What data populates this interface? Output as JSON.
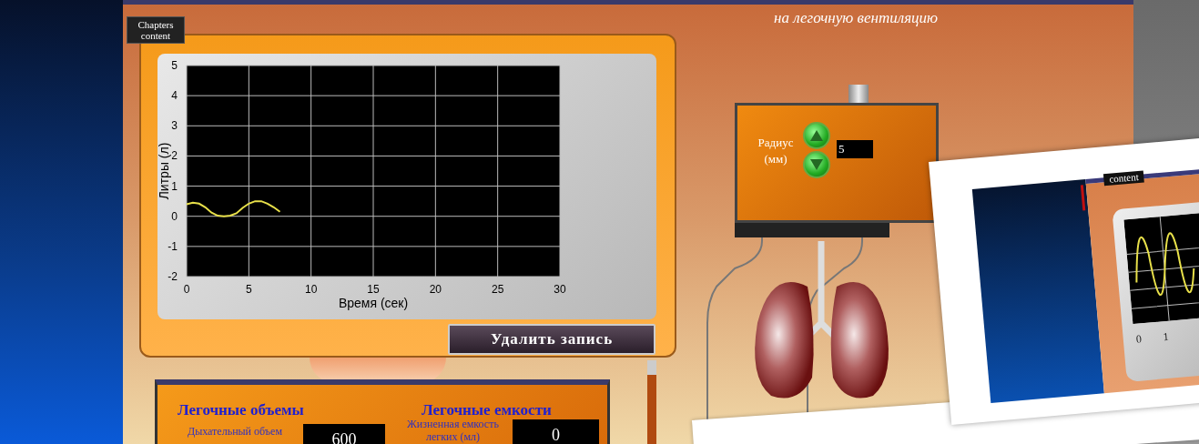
{
  "header": {
    "subtitle": "на легочную вентиляцию"
  },
  "chapters_button": {
    "label": "Chapters content"
  },
  "monitor": {
    "chart_data": {
      "type": "line",
      "grid": true,
      "xlabel": "Время (сек)",
      "ylabel": "Литры (л)",
      "xlim": [
        0,
        30
      ],
      "ylim": [
        -2,
        5
      ],
      "xticks": [
        0,
        5,
        10,
        15,
        20,
        25,
        30
      ],
      "yticks": [
        -2,
        -1,
        0,
        1,
        2,
        3,
        4,
        5
      ],
      "x": [
        0,
        0.5,
        1,
        1.5,
        2,
        2.5,
        3,
        3.5,
        4,
        4.5,
        5,
        5.5,
        6,
        6.5,
        7,
        7.5
      ],
      "series": [
        {
          "color": "#e8e04a",
          "values": [
            0.4,
            0.45,
            0.42,
            0.3,
            0.12,
            0.02,
            0.0,
            0.02,
            0.1,
            0.28,
            0.42,
            0.5,
            0.5,
            0.42,
            0.3,
            0.15
          ]
        }
      ]
    },
    "delete_button": "Удалить запись"
  },
  "radius_control": {
    "label": "Радиус (мм)",
    "value": "5"
  },
  "volumes_panel": {
    "volumes_title": "Легочные объемы",
    "capacities_title": "Легочные емкости",
    "fields": [
      {
        "label": "Дыхательный объем",
        "value": "600"
      },
      {
        "label": "Жизненная емкость легких (мл)",
        "value": "0"
      }
    ]
  },
  "overlay_screenshot": {
    "button": "content",
    "axis_labels": [
      "0",
      "1"
    ]
  }
}
